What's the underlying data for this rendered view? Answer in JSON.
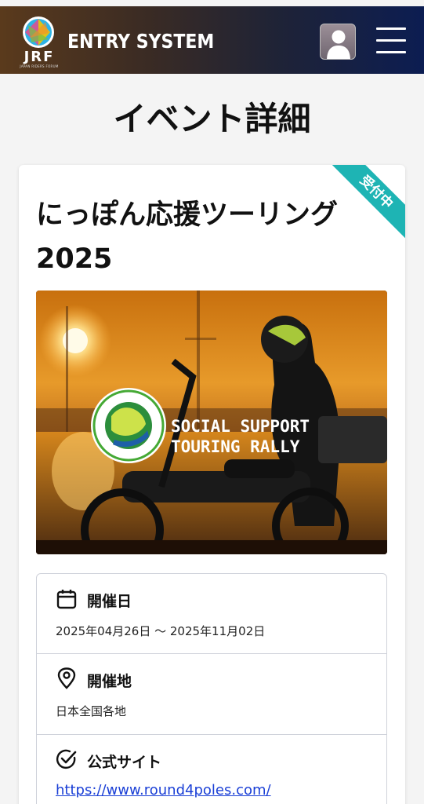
{
  "header": {
    "logo_text": "JRF",
    "logo_sub": "JAPAN RIDERS FORUM",
    "brand": "ENTRY SYSTEM"
  },
  "page": {
    "title": "イベント詳細"
  },
  "event": {
    "status_badge": "受付中",
    "title_line1": "にっぽん応援ツーリング",
    "title_line2": "2025",
    "hero": {
      "overlay_line1": "SOCIAL SUPPORT",
      "overlay_line2": "TOURING RALLY",
      "emblem_ring_text": "SOCIAL SUPPORT TOURING RALLY"
    },
    "details": [
      {
        "icon": "calendar-icon",
        "label": "開催日",
        "value": "2025年04月26日 〜 2025年11月02日"
      },
      {
        "icon": "map-pin-icon",
        "label": "開催地",
        "value": "日本全国各地"
      },
      {
        "icon": "check-circle-icon",
        "label": "公式サイト",
        "value": "https://www.round4poles.com/"
      }
    ]
  },
  "colors": {
    "header_left": "#5a3a1c",
    "header_right": "#0c1d52",
    "status_badge": "#1eb4b4",
    "link": "#1a3fd6",
    "card_border": "#cfd2da"
  }
}
